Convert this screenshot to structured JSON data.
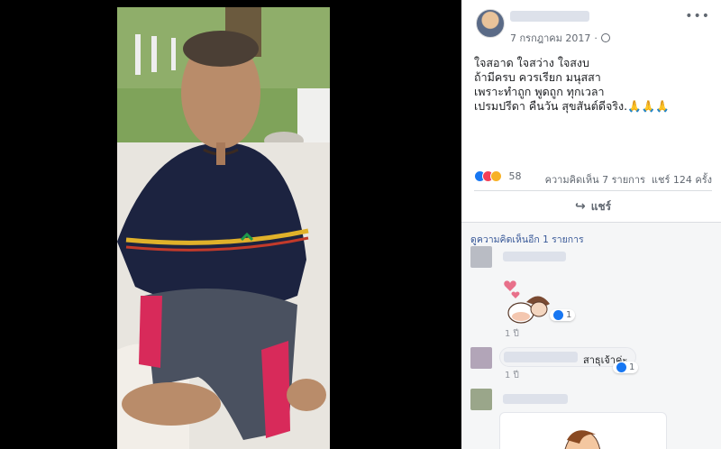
{
  "post": {
    "date": "7 กรกฎาคม 2017",
    "more_icon": "more-horizontal-icon",
    "privacy_icon": "globe-icon",
    "text_lines": [
      "ใจสอาด ใจสว่าง ใจสงบ",
      "ถ้ามีครบ ควรเรียก มนุสสา",
      "เพราะทำถูก พูดถูก ทุกเวลา",
      "เปรมปรีดา คืนวัน สุขสันต์ดีจริง."
    ],
    "text_emoji": "🙏🙏🙏"
  },
  "stats": {
    "reaction_count": "58",
    "comments": "ความคิดเห็น 7 รายการ",
    "shares": "แชร์ 124 ครั้ง"
  },
  "actions": {
    "share_label": "แชร์"
  },
  "comments": {
    "view_more": "ดูความคิดเห็นอีก 1 รายการ",
    "items": [
      {
        "time": "1 ปี",
        "likes": "1"
      },
      {
        "text": "สาธุเจ้าค่ะ",
        "time": "1 ปี",
        "likes": "1"
      }
    ]
  },
  "colors": {
    "link": "#385898",
    "like_blue": "#1877f2",
    "love_red": "#f33e58",
    "wow_yellow": "#f7b125"
  }
}
